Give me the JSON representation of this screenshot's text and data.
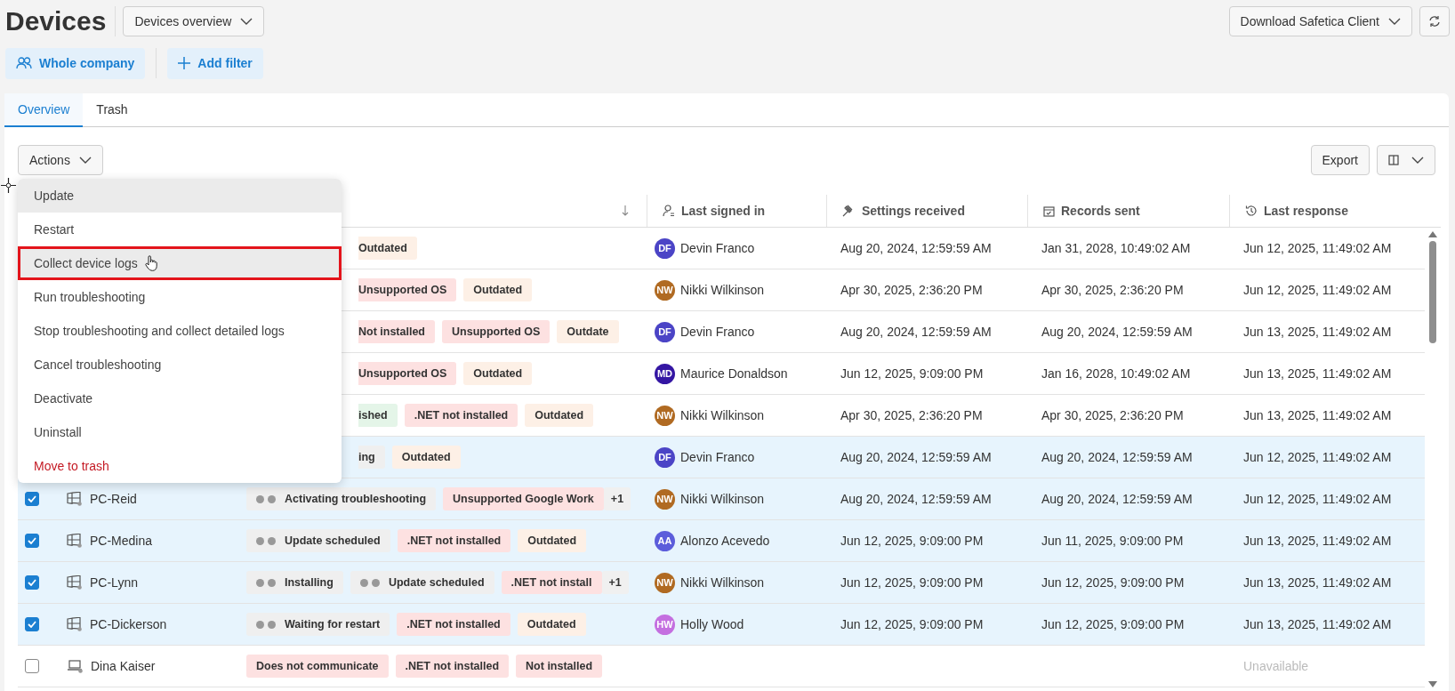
{
  "header": {
    "title": "Devices",
    "view": "Devices overview",
    "download": "Download Safetica Client"
  },
  "filters": {
    "scope": "Whole company",
    "add": "Add filter"
  },
  "tabs": [
    {
      "label": "Overview",
      "selected": true
    },
    {
      "label": "Trash",
      "selected": false
    }
  ],
  "toolbar": {
    "actions": "Actions",
    "export": "Export"
  },
  "menu": {
    "items": [
      {
        "label": "Update",
        "kind": "normal",
        "highlighted": true,
        "annotated": false
      },
      {
        "label": "Restart",
        "kind": "normal",
        "highlighted": false,
        "annotated": false
      },
      {
        "label": "Collect device logs",
        "kind": "normal",
        "highlighted": true,
        "annotated": true
      },
      {
        "label": "Run troubleshooting",
        "kind": "normal",
        "highlighted": false,
        "annotated": false
      },
      {
        "label": "Stop troubleshooting and collect detailed logs",
        "kind": "normal",
        "highlighted": false,
        "annotated": false
      },
      {
        "label": "Cancel troubleshooting",
        "kind": "normal",
        "highlighted": false,
        "annotated": false
      },
      {
        "label": "Deactivate",
        "kind": "normal",
        "highlighted": false,
        "annotated": false
      },
      {
        "label": "Uninstall",
        "kind": "normal",
        "highlighted": false,
        "annotated": false
      },
      {
        "label": "Move to trash",
        "kind": "danger",
        "highlighted": false,
        "annotated": false
      }
    ]
  },
  "table": {
    "columns": [
      {
        "label": "Last signed in"
      },
      {
        "label": "Settings received"
      },
      {
        "label": "Records sent"
      },
      {
        "label": "Last response"
      }
    ],
    "rows": [
      {
        "selected": false,
        "tags": [
          {
            "kind": "warning",
            "text": "Outdated"
          }
        ],
        "user": {
          "initials": "DF",
          "name": "Devin Franco",
          "color": "#4b44c6"
        },
        "settings": "Aug 20, 2024, 12:59:59 AM",
        "records": "Jan 31, 2028, 10:49:02 AM",
        "response": "Jun 12, 2025, 11:49:02 AM"
      },
      {
        "selected": false,
        "tags": [
          {
            "kind": "error",
            "text": "Unsupported OS"
          },
          {
            "kind": "warning",
            "text": "Outdated"
          }
        ],
        "user": {
          "initials": "NW",
          "name": "Nikki Wilkinson",
          "color": "#b06a22"
        },
        "settings": "Apr 30, 2025, 2:36:20 PM",
        "records": "Apr 30, 2025, 2:36:20 PM",
        "response": "Jun 12, 2025, 11:49:02 AM"
      },
      {
        "selected": false,
        "tags": [
          {
            "kind": "error",
            "text": "Not installed"
          },
          {
            "kind": "error",
            "text": "Unsupported OS"
          },
          {
            "kind": "warning",
            "text": "Outdate"
          }
        ],
        "user": {
          "initials": "DF",
          "name": "Devin Franco",
          "color": "#4b44c6"
        },
        "settings": "Aug 20, 2024, 12:59:59 AM",
        "records": "Aug 20, 2024, 12:59:59 AM",
        "response": "Jun 13, 2025, 11:49:02 AM"
      },
      {
        "selected": false,
        "tags": [
          {
            "kind": "error",
            "text": "Unsupported OS"
          },
          {
            "kind": "warning",
            "text": "Outdated"
          }
        ],
        "user": {
          "initials": "MD",
          "name": "Maurice Donaldson",
          "color": "#3416a3"
        },
        "settings": "Jun 12, 2025, 9:09:00 PM",
        "records": "Jan 16, 2028, 10:49:02 AM",
        "response": "Jun 13, 2025, 11:49:02 AM"
      },
      {
        "selected": false,
        "tags": [
          {
            "kind": "success",
            "text": "ished"
          },
          {
            "kind": "error",
            "text": ".NET not installed"
          },
          {
            "kind": "warning",
            "text": "Outdated"
          }
        ],
        "user": {
          "initials": "NW",
          "name": "Nikki Wilkinson",
          "color": "#b06a22"
        },
        "settings": "Apr 30, 2025, 2:36:20 PM",
        "records": "Apr 30, 2025, 2:36:20 PM",
        "response": "Jun 13, 2025, 11:49:02 AM"
      },
      {
        "selected": true,
        "tags": [
          {
            "kind": "status",
            "text": "ing"
          },
          {
            "kind": "warning",
            "text": "Outdated"
          }
        ],
        "user": {
          "initials": "DF",
          "name": "Devin Franco",
          "color": "#4b44c6"
        },
        "settings": "Aug 20, 2024, 12:59:59 AM",
        "records": "Aug 20, 2024, 12:59:59 AM",
        "response": "Jun 12, 2025, 11:49:02 AM"
      },
      {
        "selected": true,
        "device": {
          "name": "PC-Reid",
          "kind": "desktop"
        },
        "tags": [
          {
            "kind": "status",
            "text": "Activating troubleshooting"
          },
          {
            "kind": "error",
            "text": "Unsupported Google Work"
          },
          {
            "kind": "more",
            "text": "+1"
          }
        ],
        "user": {
          "initials": "NW",
          "name": "Nikki Wilkinson",
          "color": "#b06a22"
        },
        "settings": "Aug 20, 2024, 12:59:59 AM",
        "records": "Aug 20, 2024, 12:59:59 AM",
        "response": "Jun 12, 2025, 11:49:02 AM"
      },
      {
        "selected": true,
        "device": {
          "name": "PC-Medina",
          "kind": "desktop"
        },
        "tags": [
          {
            "kind": "status",
            "text": "Update scheduled"
          },
          {
            "kind": "error",
            "text": ".NET not installed"
          },
          {
            "kind": "warning",
            "text": "Outdated"
          }
        ],
        "user": {
          "initials": "AA",
          "name": "Alonzo Acevedo",
          "color": "#5c5ddb"
        },
        "settings": "Jun 12, 2025, 9:09:00 PM",
        "records": "Jun 11, 2025, 9:09:00 PM",
        "response": "Jun 13, 2025, 11:49:02 AM"
      },
      {
        "selected": true,
        "device": {
          "name": "PC-Lynn",
          "kind": "desktop"
        },
        "tags": [
          {
            "kind": "status",
            "text": "Installing"
          },
          {
            "kind": "status",
            "text": "Update scheduled"
          },
          {
            "kind": "error",
            "text": ".NET not install"
          },
          {
            "kind": "more",
            "text": "+1"
          }
        ],
        "user": {
          "initials": "NW",
          "name": "Nikki Wilkinson",
          "color": "#b06a22"
        },
        "settings": "Jun 12, 2025, 9:09:00 PM",
        "records": "Jun 12, 2025, 9:09:00 PM",
        "response": "Jun 13, 2025, 11:49:02 AM"
      },
      {
        "selected": true,
        "device": {
          "name": "PC-Dickerson",
          "kind": "desktop"
        },
        "tags": [
          {
            "kind": "status",
            "text": "Waiting for restart"
          },
          {
            "kind": "error",
            "text": ".NET not installed"
          },
          {
            "kind": "warning",
            "text": "Outdated"
          }
        ],
        "user": {
          "initials": "HW",
          "name": "Holly Wood",
          "color": "#c46fe0"
        },
        "settings": "Jun 12, 2025, 9:09:00 PM",
        "records": "Jun 12, 2025, 9:09:00 PM",
        "response": "Jun 13, 2025, 11:49:02 AM"
      },
      {
        "selected": false,
        "device": {
          "name": "Dina Kaiser",
          "kind": "laptop"
        },
        "tags": [
          {
            "kind": "error",
            "text": "Does not communicate"
          },
          {
            "kind": "error",
            "text": ".NET not installed"
          },
          {
            "kind": "error",
            "text": "Not installed"
          }
        ],
        "response": "Unavailable",
        "response_unavailable": true
      }
    ]
  }
}
